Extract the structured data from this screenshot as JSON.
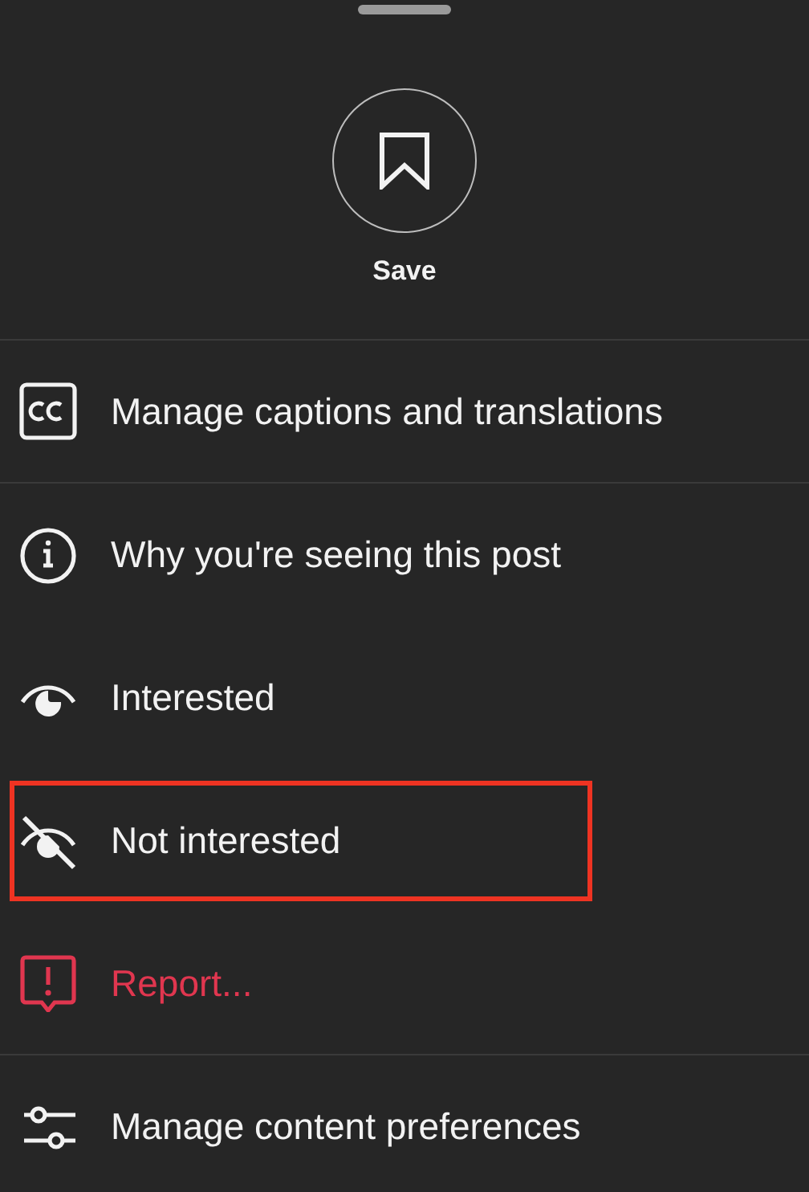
{
  "save": {
    "label": "Save"
  },
  "menu": [
    {
      "label": "Manage captions and translations",
      "kind": "normal",
      "highlighted": false,
      "divider_after": true
    },
    {
      "label": "Why you're seeing this post",
      "kind": "normal",
      "highlighted": false,
      "divider_after": false
    },
    {
      "label": "Interested",
      "kind": "normal",
      "highlighted": false,
      "divider_after": false
    },
    {
      "label": "Not interested",
      "kind": "normal",
      "highlighted": true,
      "divider_after": false
    },
    {
      "label": "Report...",
      "kind": "danger",
      "highlighted": false,
      "divider_after": true
    },
    {
      "label": "Manage content preferences",
      "kind": "normal",
      "highlighted": false,
      "divider_after": false
    }
  ]
}
